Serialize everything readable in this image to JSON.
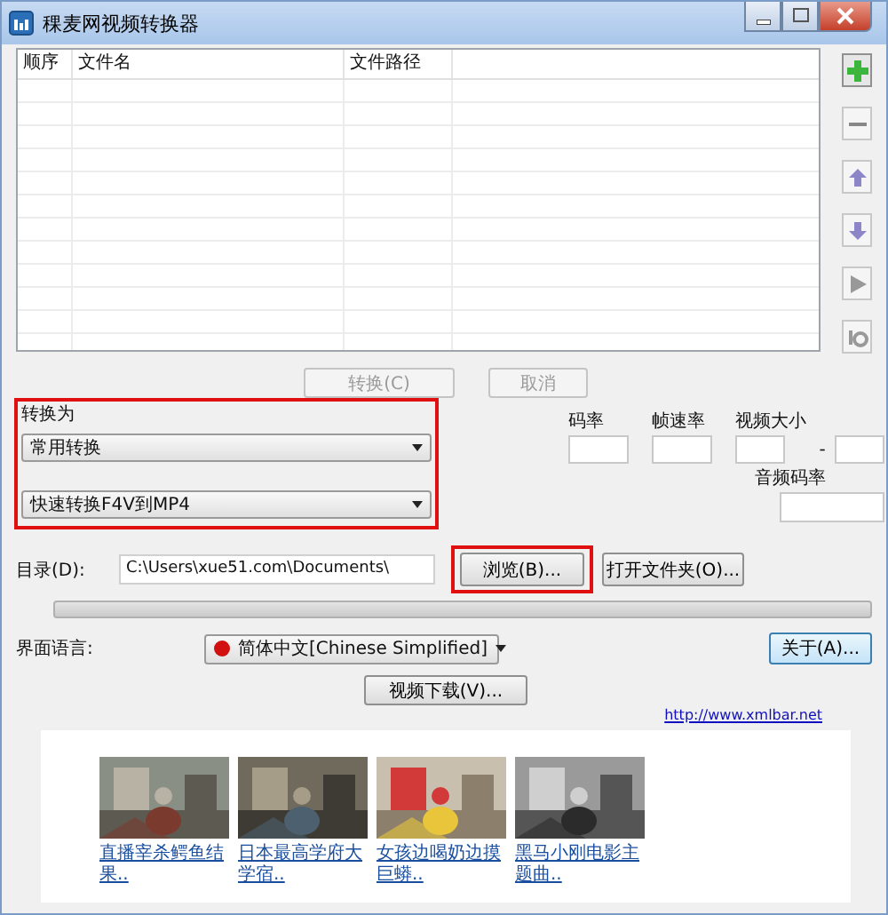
{
  "window": {
    "title": "稞麦网视频转换器"
  },
  "file_list": {
    "columns": [
      "顺序",
      "文件名",
      "文件路径"
    ]
  },
  "actions": [
    {
      "label": "转换(C)",
      "disabled": true
    },
    {
      "label": "取消",
      "disabled": true
    }
  ],
  "convert_to": {
    "label": "转换为",
    "highlighted": true,
    "category": "常用转换",
    "preset": "快速转换F4V到MP4"
  },
  "video_params": {
    "bitrate": "码率",
    "frame_rate": "帧速率",
    "video_size": "视频大小",
    "size_separator": "-",
    "audio_bitrate": "音频码率"
  },
  "directory": {
    "label": "目录(D):",
    "value": "C:\\Users\\xue51.com\\Documents\\"
  },
  "browse_button": {
    "label": "浏览(B)...",
    "highlighted": true
  },
  "open_folder_button": {
    "label": "打开文件夹(O)..."
  },
  "progress": {
    "level": 0
  },
  "language": {
    "label": "界面语言:",
    "value": "简体中文[Chinese Simplified]"
  },
  "about_button": {
    "label": "关于(A)..."
  },
  "download_button": {
    "label": "视频下载(V)..."
  },
  "link": "http://www.xmlbar.net",
  "videos": [
    {
      "kind": "picture",
      "caption": "直播宰杀鳄鱼结果.."
    },
    {
      "kind": "picture",
      "caption": "日本最高学府大学宿.."
    },
    {
      "kind": "picture",
      "caption": "女孩边喝奶边摸巨蟒.."
    },
    {
      "kind": "picture",
      "caption": "黑马小刚电影主题曲.."
    }
  ]
}
